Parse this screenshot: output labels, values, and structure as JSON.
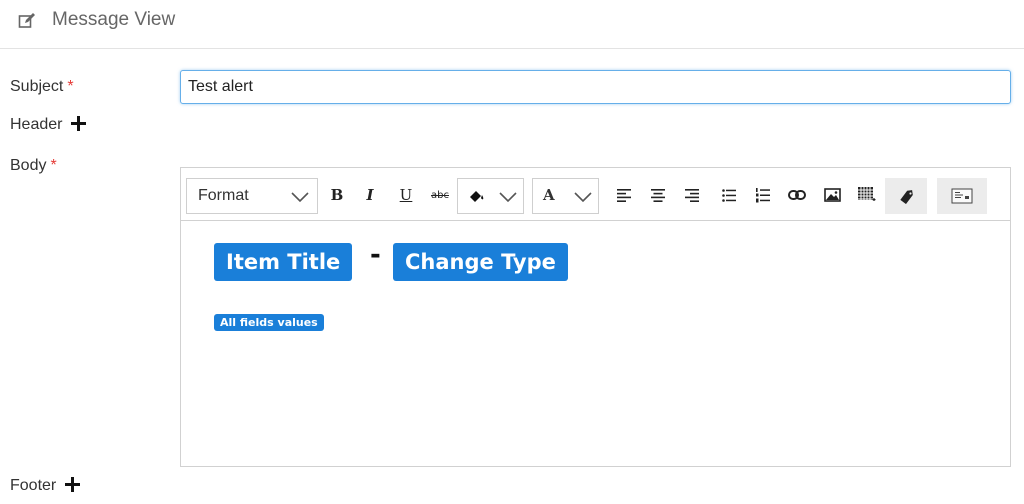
{
  "header": {
    "title": "Message View",
    "icon": "edit-icon"
  },
  "form": {
    "subject": {
      "label": "Subject",
      "required_mark": "*",
      "value": "Test alert"
    },
    "header": {
      "label": "Header",
      "add_icon": "plus-icon"
    },
    "body": {
      "label": "Body",
      "required_mark": "*"
    },
    "footer": {
      "label": "Footer",
      "add_icon": "plus-icon"
    }
  },
  "toolbar": {
    "format_label": "Format",
    "bold": "B",
    "italic": "I",
    "underline": "U",
    "strike": "abc",
    "font_color": "A",
    "icons": [
      "bold-icon",
      "italic-icon",
      "underline-icon",
      "strikethrough-icon",
      "highlight-color-icon",
      "font-color-icon",
      "align-left-icon",
      "align-center-icon",
      "align-right-icon",
      "bullet-list-icon",
      "numbered-list-icon",
      "link-icon",
      "image-icon",
      "table-icon",
      "tag-icon",
      "source-icon"
    ]
  },
  "body_content": {
    "item_title": "Item Title",
    "separator": "-",
    "change_type": "Change Type",
    "all_fields": "All fields values"
  },
  "colors": {
    "chip": "#1a7fd9",
    "required": "#e53935",
    "focus_border": "#66afe9"
  }
}
